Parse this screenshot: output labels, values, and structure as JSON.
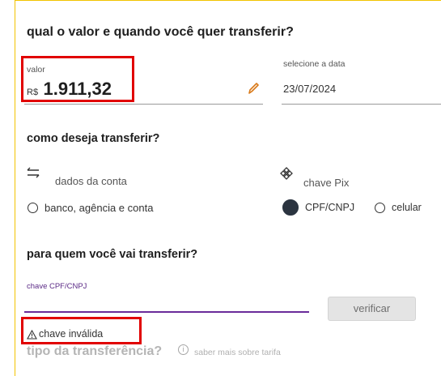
{
  "header": {
    "title": "qual o valor e quando você quer transferir?"
  },
  "valor": {
    "label": "valor",
    "currency": "R$",
    "amount": "1.911,32"
  },
  "date": {
    "label": "selecione a data",
    "value": "23/07/2024"
  },
  "how": {
    "title": "como deseja transferir?",
    "option_account": "dados da conta",
    "option_pix": "chave Pix",
    "radio_bank": "banco, agência e conta",
    "radio_cpf": "CPF/CNPJ",
    "radio_cel": "celular"
  },
  "who": {
    "title": "para quem você vai transferir?",
    "key_label": "chave CPF/CNPJ",
    "verify_button": "verificar",
    "error": "chave inválida"
  },
  "type": {
    "title": "tipo da transferência?",
    "info_link": "saber mais sobre tarifa"
  },
  "colors": {
    "highlight_red": "#e10000",
    "accent_purple": "#6a2c9a",
    "frame_yellow": "#f2c400"
  }
}
